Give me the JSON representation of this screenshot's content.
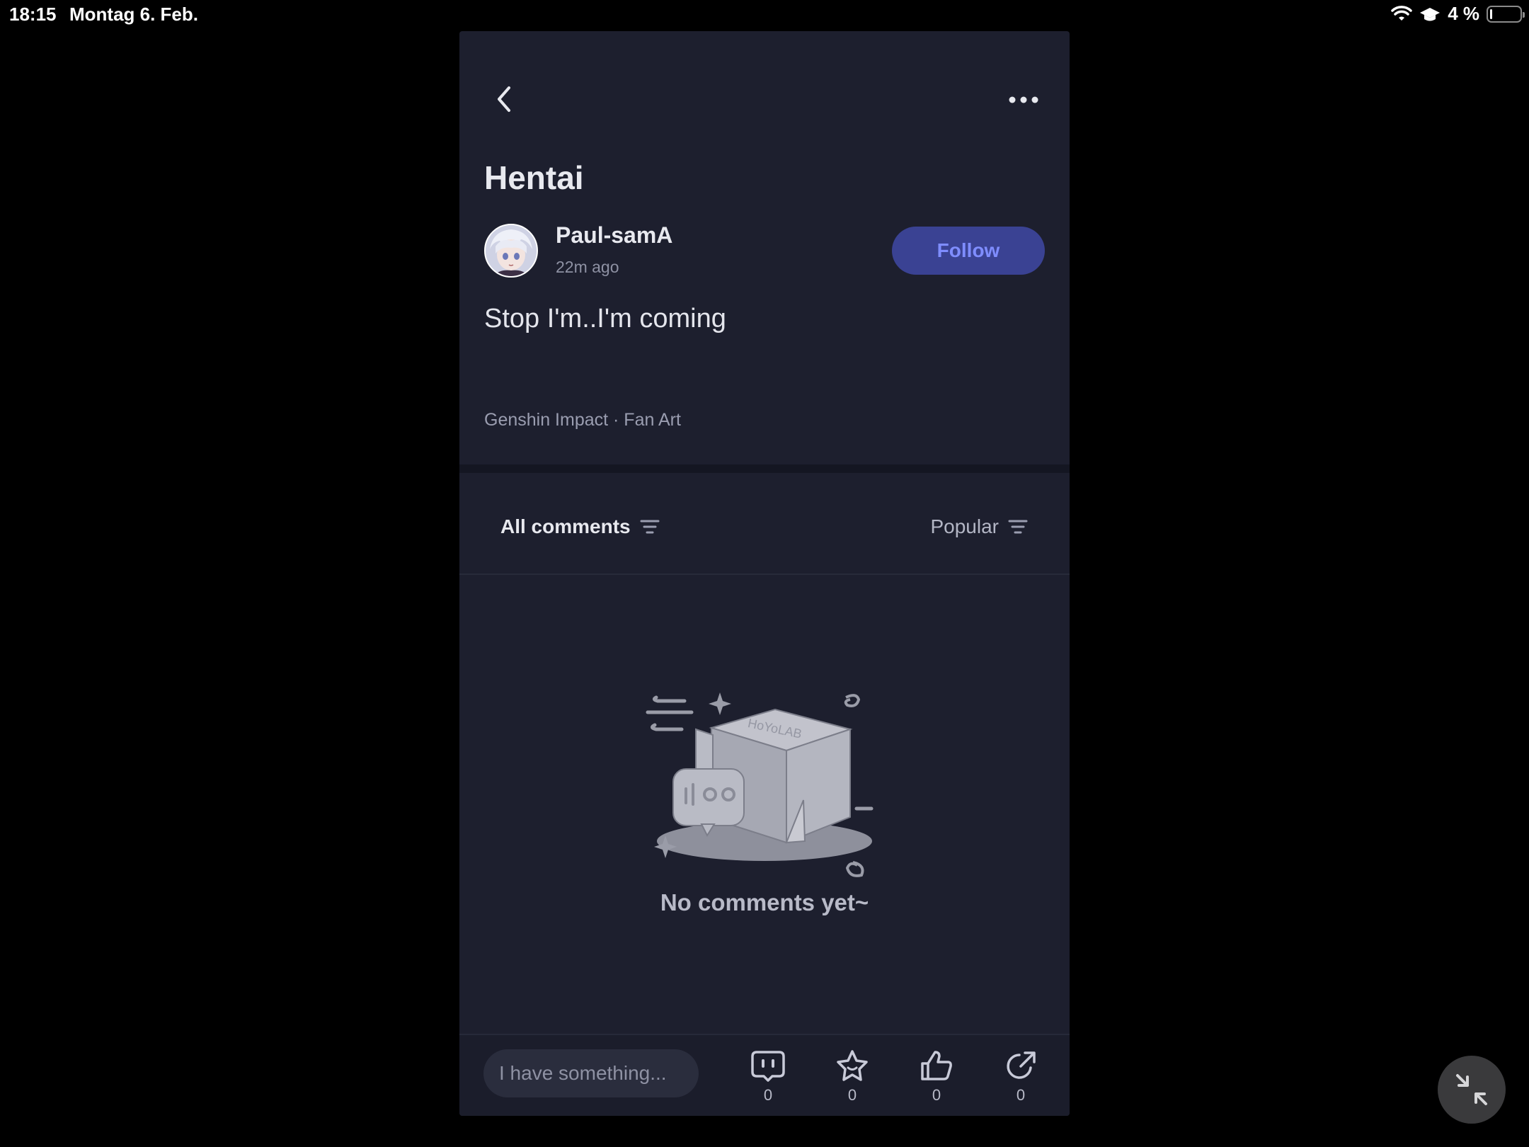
{
  "status_bar": {
    "time": "18:15",
    "date": "Montag 6. Feb.",
    "battery_text": "4 %"
  },
  "post": {
    "title": "Hentai",
    "author": "Paul-samA",
    "time_ago": "22m ago",
    "follow_label": "Follow",
    "body": "Stop I'm..I'm coming",
    "tags": "Genshin Impact · Fan Art"
  },
  "comments": {
    "filter_label": "All comments",
    "sort_label": "Popular",
    "empty_text": "No comments yet~",
    "illustration_text": "HoYoLAB"
  },
  "bottom_bar": {
    "input_placeholder": "I have something...",
    "actions": [
      {
        "icon": "comment-icon",
        "count": "0"
      },
      {
        "icon": "star-icon",
        "count": "0"
      },
      {
        "icon": "thumbs-up-icon",
        "count": "0"
      },
      {
        "icon": "share-icon",
        "count": "0"
      }
    ]
  },
  "colors": {
    "panel_bg": "#1d1f2e",
    "accent": "#7f8dff",
    "follow_bg": "#3a4293"
  }
}
